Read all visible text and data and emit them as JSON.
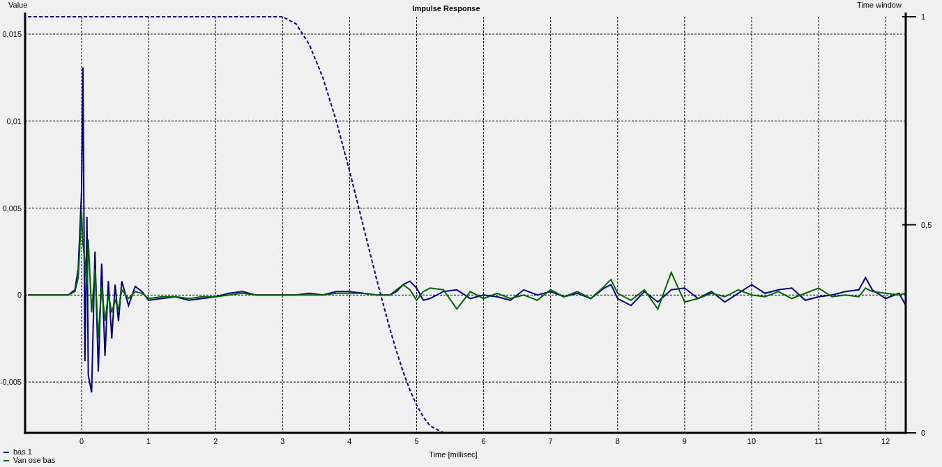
{
  "chart_data": {
    "type": "line",
    "grid": true,
    "legend": true,
    "title": "Impulse Response",
    "xlabel": "Time [millisec]",
    "ylabel": "Value",
    "y2label": "Time window",
    "xlim": [
      -0.843,
      12.3
    ],
    "ylim": [
      -0.00792,
      0.016
    ],
    "y2lim": [
      0,
      1
    ],
    "xticks": [
      0,
      1,
      2,
      3,
      4,
      5,
      6,
      7,
      8,
      9,
      10,
      11,
      12
    ],
    "yticks": [
      {
        "value": 0.015,
        "label": "0,015"
      },
      {
        "value": 0.01,
        "label": "0,01"
      },
      {
        "value": 0.005,
        "label": "0,005"
      },
      {
        "value": 0,
        "label": "0"
      },
      {
        "value": -0.005,
        "label": "-0,005"
      }
    ],
    "y2ticks": [
      {
        "value": 1,
        "label": "1"
      },
      {
        "value": 0.5,
        "label": "0,5"
      },
      {
        "value": 0,
        "label": "0"
      }
    ],
    "x": [
      -0.8,
      -0.4,
      -0.2,
      -0.1,
      -0.05,
      0,
      0.02,
      0.05,
      0.08,
      0.1,
      0.15,
      0.2,
      0.25,
      0.3,
      0.35,
      0.4,
      0.45,
      0.5,
      0.55,
      0.6,
      0.7,
      0.8,
      0.9,
      1,
      1.2,
      1.4,
      1.6,
      1.8,
      2,
      2.2,
      2.4,
      2.6,
      2.8,
      3,
      3.2,
      3.4,
      3.6,
      3.8,
      4,
      4.2,
      4.4,
      4.6,
      4.7,
      4.8,
      4.9,
      5,
      5.1,
      5.2,
      5.4,
      5.6,
      5.8,
      6,
      6.2,
      6.4,
      6.6,
      6.8,
      7,
      7.2,
      7.4,
      7.6,
      7.8,
      7.9,
      8,
      8.2,
      8.4,
      8.6,
      8.8,
      9,
      9.2,
      9.4,
      9.6,
      9.8,
      10,
      10.2,
      10.4,
      10.6,
      10.8,
      11,
      11.2,
      11.4,
      11.6,
      11.7,
      11.8,
      12,
      12.2,
      12.3
    ],
    "series": [
      {
        "name": "bas 1",
        "color": "#000080",
        "line_style": "solid",
        "values": [
          0,
          0,
          0,
          0.0003,
          0.0015,
          0.006,
          0.0131,
          -0.0038,
          0.0045,
          -0.0046,
          -0.0056,
          0.0025,
          -0.0044,
          0.0018,
          -0.0035,
          0.0008,
          -0.0025,
          0.0006,
          -0.0015,
          0.0008,
          -0.0006,
          0.0005,
          0.0002,
          -0.0003,
          -0.0002,
          -0.0001,
          -0.0003,
          -0.0002,
          -0.0001,
          0.0001,
          0.0002,
          0,
          0,
          0,
          0,
          0.0001,
          0,
          0.0002,
          0.0002,
          0.0001,
          0,
          0,
          0.0002,
          0.0006,
          0.0008,
          0.0004,
          -0.0003,
          -0.0002,
          0.0002,
          0.0003,
          -0.0002,
          0,
          -0.0001,
          -0.0003,
          0.0003,
          0,
          0.0002,
          -0.0001,
          0.0001,
          -0.0002,
          0.0004,
          0.0006,
          -0.0002,
          -0.0006,
          0.0002,
          -0.0004,
          0.0003,
          0.0004,
          -0.0002,
          0.0002,
          -0.0004,
          0.0001,
          0.0006,
          0.0001,
          0.0003,
          0.0004,
          -0.0003,
          -0.0001,
          0,
          0.0002,
          0.0003,
          0.001,
          0.0003,
          -0.0002,
          0.0001,
          -0.0006
        ]
      },
      {
        "name": "Van ose bas",
        "color": "#006400",
        "line_style": "solid",
        "values": [
          0,
          0,
          0,
          0.0002,
          0.001,
          0.0048,
          0.003,
          0.002,
          0.0005,
          0.0032,
          -0.001,
          0.0015,
          -0.0025,
          0.0005,
          -0.0015,
          0,
          -0.001,
          -0.0003,
          -0.0008,
          0.0003,
          -0.0002,
          0.0002,
          0.0001,
          -0.0002,
          -0.0001,
          -0.0001,
          -0.0002,
          -0.0001,
          -0.0001,
          0,
          0.0001,
          0,
          0,
          0,
          0,
          0,
          0,
          0.0001,
          0.0001,
          0.0001,
          0,
          0,
          0.0003,
          0.0006,
          0.0003,
          -0.0003,
          0.0002,
          0.0004,
          0.0003,
          -0.0008,
          0.0002,
          -0.0002,
          0.0001,
          -0.0002,
          0,
          -0.0003,
          0.0003,
          -0.0001,
          0.0002,
          -0.0002,
          0.0005,
          0.0009,
          0.0001,
          -0.0003,
          0.0003,
          -0.0008,
          0.0013,
          -0.0004,
          -0.0002,
          0.0001,
          -0.0001,
          0.0003,
          0,
          -0.0001,
          0.0002,
          -0.0002,
          0.0001,
          0.0004,
          -0.0001,
          0,
          -0.0001,
          0.0004,
          0.0002,
          0.0001,
          0,
          0.0001
        ]
      },
      {
        "color": "#000080",
        "axis": "y2",
        "line_style": "dashed",
        "values": [
          1,
          1,
          1,
          1,
          1,
          1,
          1,
          1,
          1,
          1,
          1,
          1,
          1,
          1,
          1,
          1,
          1,
          1,
          1,
          1,
          1,
          1,
          1,
          1,
          1,
          1,
          1,
          1,
          1,
          1,
          1,
          1,
          1,
          1,
          0.983,
          0.933,
          0.854,
          0.75,
          0.629,
          0.5,
          0.371,
          0.25,
          0.196,
          0.146,
          0.103,
          0.067,
          0.038,
          0.017,
          0,
          null,
          null,
          null,
          null,
          null,
          null,
          null,
          null,
          null,
          null,
          null,
          null,
          null,
          null,
          null,
          null,
          null,
          null,
          null,
          null,
          null,
          null,
          null,
          null,
          null,
          null,
          null,
          null,
          null,
          null,
          null,
          null,
          null,
          null,
          null,
          null,
          null
        ]
      }
    ]
  }
}
